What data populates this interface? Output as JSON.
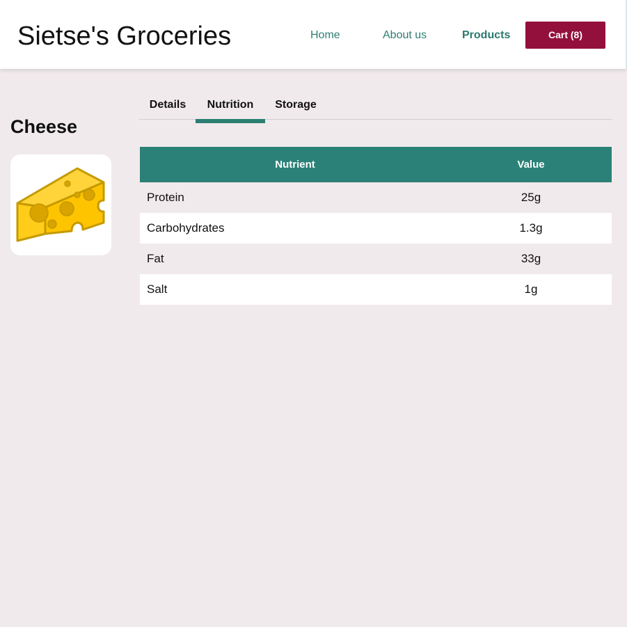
{
  "header": {
    "site_title": "Sietse's Groceries",
    "nav": [
      {
        "label": "Home"
      },
      {
        "label": "About us"
      },
      {
        "label": "Products",
        "active": true
      }
    ],
    "cart_label": "Cart (8)"
  },
  "product": {
    "name": "Cheese",
    "image_icon": "cheese-icon"
  },
  "tabs": [
    {
      "label": "Details"
    },
    {
      "label": "Nutrition",
      "active": true
    },
    {
      "label": "Storage"
    }
  ],
  "nutrition_table": {
    "headers": [
      "Nutrient",
      "Value"
    ],
    "rows": [
      {
        "nutrient": "Protein",
        "value": "25g"
      },
      {
        "nutrient": "Carbohydrates",
        "value": "1.3g"
      },
      {
        "nutrient": "Fat",
        "value": "33g"
      },
      {
        "nutrient": "Salt",
        "value": "1g"
      }
    ]
  },
  "colors": {
    "accent": "#2b8177",
    "cart": "#93103d",
    "background": "#f1eaec"
  }
}
